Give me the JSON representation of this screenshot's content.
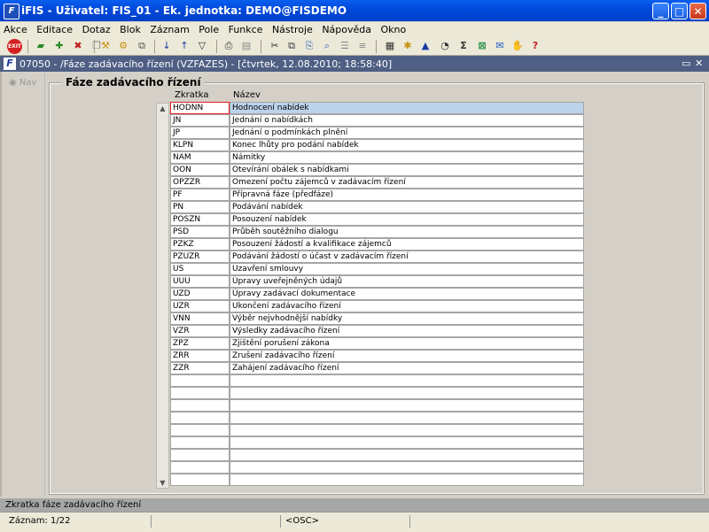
{
  "window": {
    "title": "iFIS - Uživatel: FIS_01 - Ek. jednotka: DEMO@FISDEMO",
    "minimize": "_",
    "maximize": "□",
    "close": "✕"
  },
  "menu": [
    "Akce",
    "Editace",
    "Dotaz",
    "Blok",
    "Záznam",
    "Pole",
    "Funkce",
    "Nástroje",
    "Nápověda",
    "Okno"
  ],
  "toolbar": {
    "exit_label": "EXIT",
    "icons": [
      "save-icon",
      "add-record-icon",
      "delete-record-icon",
      "duplicate-icon",
      "enter-query-icon",
      "execute-query-icon",
      "sort-asc-icon",
      "sort-desc-icon",
      "filter-icon",
      "print-icon",
      "print-preview-icon",
      "cut-icon",
      "copy-icon",
      "paste-icon",
      "find-icon",
      "list-icon",
      "calculator-icon",
      "settings-icon",
      "chart-icon",
      "clock-icon",
      "sum-icon",
      "excel-icon",
      "email-icon",
      "help-icon",
      "question-icon"
    ]
  },
  "form": {
    "title": "07050 - /Fáze zadávacího řízení (VZFAZES) - [čtvrtek, 12.08.2010; 18:58:40]",
    "restore_label": "▭",
    "close_label": "✕",
    "icon_letter": "F"
  },
  "nav": {
    "label": "Nav"
  },
  "group": {
    "title": "Fáze zadávacího řízení",
    "col_code": "Zkratka",
    "col_name": "Název"
  },
  "rows": [
    {
      "code": "HODNN",
      "name": "Hodnocení nabídek"
    },
    {
      "code": "JN",
      "name": "Jednání o nabídkách"
    },
    {
      "code": "JP",
      "name": "Jednání o podmínkách plnění"
    },
    {
      "code": "KLPN",
      "name": "Konec lhůty pro podání nabídek"
    },
    {
      "code": "NAM",
      "name": "Námitky"
    },
    {
      "code": "OON",
      "name": "Otevírání obálek s nabídkami"
    },
    {
      "code": "OPZZR",
      "name": "Omezení počtu zájemců v zadávacím řízení"
    },
    {
      "code": "PF",
      "name": "Přípravná fáze (předfáze)"
    },
    {
      "code": "PN",
      "name": "Podávání nabídek"
    },
    {
      "code": "POSZN",
      "name": "Posouzení nabídek"
    },
    {
      "code": "PSD",
      "name": "Průběh soutěžního dialogu"
    },
    {
      "code": "PZKZ",
      "name": "Posouzení žádostí a kvalifikace zájemců"
    },
    {
      "code": "PZUZR",
      "name": "Podávání žádostí o účast v zadávacím řízení"
    },
    {
      "code": "US",
      "name": "Uzavření smlouvy"
    },
    {
      "code": "UUU",
      "name": "Úpravy uveřejněných údajů"
    },
    {
      "code": "UZD",
      "name": "Úpravy zadávací dokumentace"
    },
    {
      "code": "UZR",
      "name": "Ukončení zadávacího řízení"
    },
    {
      "code": "VNN",
      "name": "Výběr nejvhodnější nabídky"
    },
    {
      "code": "VZR",
      "name": "Výsledky zadávacího řízení"
    },
    {
      "code": "ZPZ",
      "name": "Zjištění porušení zákona"
    },
    {
      "code": "ZRR",
      "name": "Zrušení zadávacího řízení"
    },
    {
      "code": "ZZR",
      "name": "Zahájení zadávacího řízení"
    },
    {
      "code": "",
      "name": ""
    },
    {
      "code": "",
      "name": ""
    },
    {
      "code": "",
      "name": ""
    },
    {
      "code": "",
      "name": ""
    },
    {
      "code": "",
      "name": ""
    },
    {
      "code": "",
      "name": ""
    },
    {
      "code": "",
      "name": ""
    },
    {
      "code": "",
      "name": ""
    },
    {
      "code": "",
      "name": ""
    }
  ],
  "hint": "Zkratka fáze zadávacího řízení",
  "status": {
    "record": "Záznam: 1/22",
    "mode": "<OSC>"
  }
}
